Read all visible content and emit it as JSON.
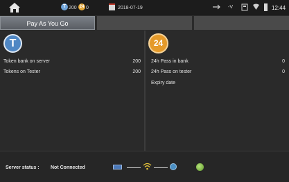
{
  "topbar": {
    "home_icon": "home-icon",
    "token_count": "200",
    "pass_count": "0",
    "date": "2018-07-19",
    "voltage": "-V",
    "time": "12:44"
  },
  "tabs": [
    {
      "label": "Pay As You Go",
      "active": true
    },
    {
      "label": "",
      "active": false
    },
    {
      "label": "",
      "active": false
    }
  ],
  "left_panel": {
    "logo_text": "T",
    "rows": [
      {
        "label": "Token bank on server",
        "value": "200"
      },
      {
        "label": "Tokens on Tester",
        "value": "200"
      }
    ]
  },
  "right_panel": {
    "logo_text": "24",
    "rows": [
      {
        "label": "24h Pass in bank",
        "value": "0"
      },
      {
        "label": "24h Pass on tester",
        "value": "0"
      },
      {
        "label": "Expiry date",
        "value": ""
      }
    ]
  },
  "status": {
    "label": "Server status :",
    "value": "Not Connected"
  },
  "colors": {
    "accent_blue": "#4f87c4",
    "accent_orange": "#e59a2a",
    "server_ok": "#5e9a2a"
  }
}
